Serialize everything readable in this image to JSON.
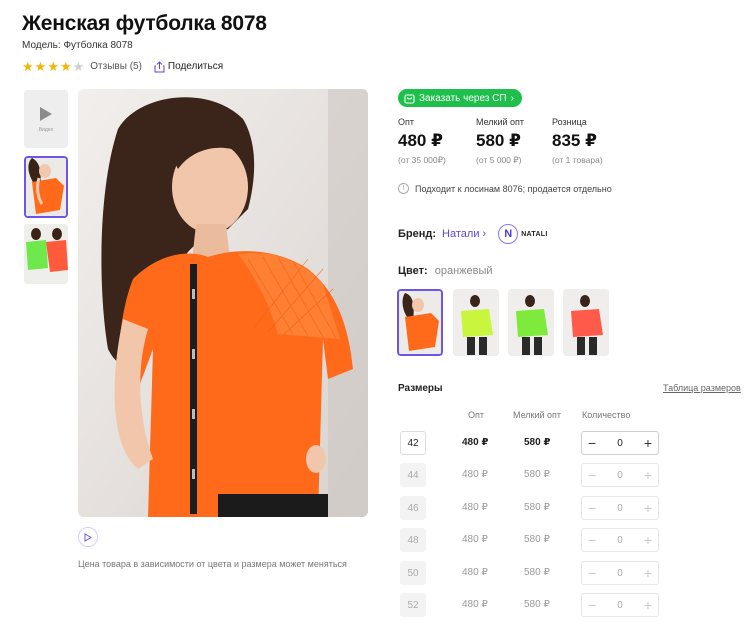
{
  "product": {
    "title": "Женская футболка 8078",
    "model": "Модель: Футболка 8078",
    "rating": 4,
    "reviews_label": "Отзывы (5)",
    "share_label": "Поделиться"
  },
  "gallery": {
    "video_label": "Видео",
    "price_note": "Цена товара в зависимости от цвета и размера может меняться"
  },
  "order": {
    "sp_button": "Заказать через СП"
  },
  "prices": [
    {
      "label": "Опт",
      "value": "480 ₽",
      "condition": "(от 35 000₽)"
    },
    {
      "label": "Мелкий опт",
      "value": "580 ₽",
      "condition": "(от 5 000 ₽)"
    },
    {
      "label": "Розница",
      "value": "835 ₽",
      "condition": "(от 1 товара)"
    }
  ],
  "fits_note": "Подходит к лосинам 8076; продается отдельно",
  "brand": {
    "label": "Бренд:",
    "name": "Натали",
    "logo_text": "NATALI"
  },
  "color": {
    "label": "Цвет:",
    "value": "оранжевый",
    "swatches": [
      "#ff6a1a",
      "#c9f53c",
      "#7dea3c",
      "#ff5a4a"
    ]
  },
  "sizes": {
    "title": "Размеры",
    "table_link": "Таблица размеров",
    "columns": [
      "Опт",
      "Мелкий опт",
      "Количество"
    ],
    "rows": [
      {
        "size": "42",
        "opt": "480 ₽",
        "small": "580 ₽",
        "qty": "0",
        "minus": "−",
        "plus": "+"
      },
      {
        "size": "44",
        "opt": "480 ₽",
        "small": "580 ₽",
        "qty": "0",
        "minus": "−",
        "plus": "+"
      },
      {
        "size": "46",
        "opt": "480 ₽",
        "small": "580 ₽",
        "qty": "0",
        "minus": "−",
        "plus": "+"
      },
      {
        "size": "48",
        "opt": "480 ₽",
        "small": "580 ₽",
        "qty": "0",
        "minus": "−",
        "plus": "+"
      },
      {
        "size": "50",
        "opt": "480 ₽",
        "small": "580 ₽",
        "qty": "0",
        "minus": "−",
        "plus": "+"
      },
      {
        "size": "52",
        "opt": "480 ₽",
        "small": "580 ₽",
        "qty": "0",
        "minus": "−",
        "plus": "+"
      }
    ]
  },
  "colors": {
    "accent": "#6d55e6",
    "green": "#1fbf4b",
    "star": "#f5b400",
    "shirt_orange": "#ff6a1a"
  }
}
